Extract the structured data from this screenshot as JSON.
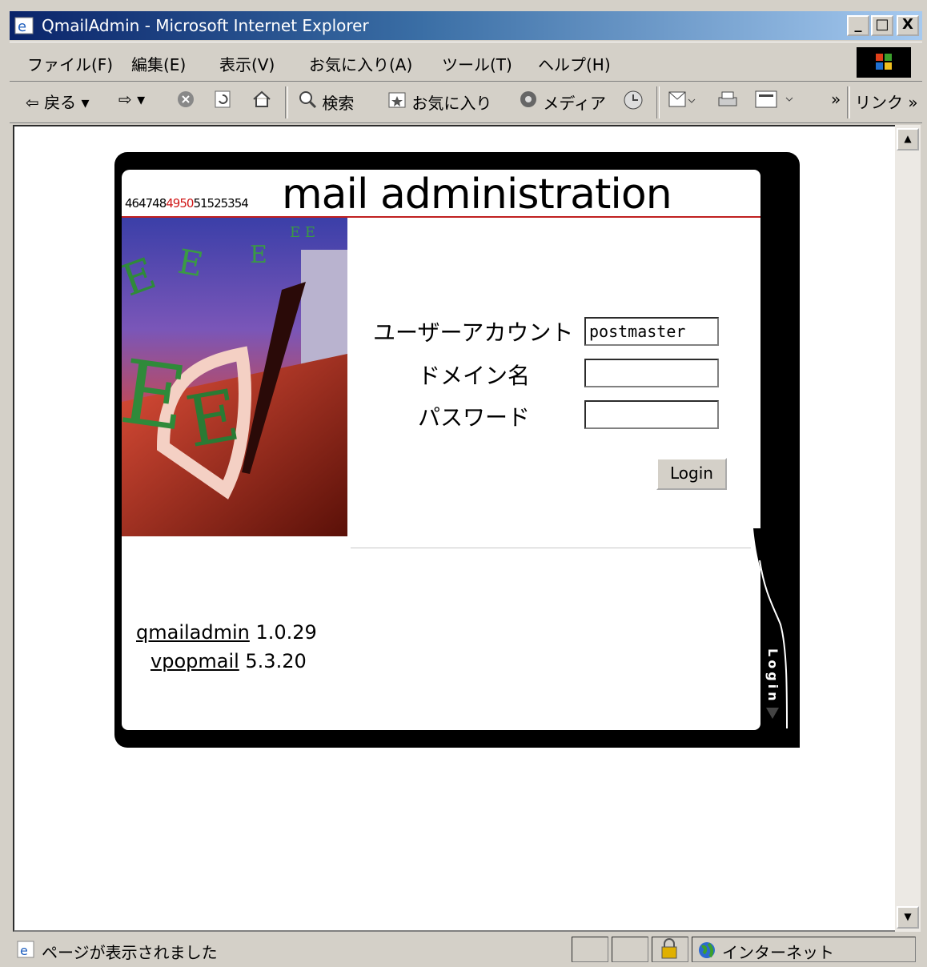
{
  "window": {
    "title": "QmailAdmin - Microsoft Internet Explorer",
    "buttons": [
      "_",
      "□",
      "X"
    ]
  },
  "menu": [
    "ファイル(F)",
    "編集(E)",
    "表示(V)",
    "お気に入り(A)",
    "ツール(T)",
    "ヘルプ(H)"
  ],
  "toolbar": {
    "back": "⇦ 戻る ▾",
    "forward": "⇨ ▾",
    "search": "検索",
    "favorites": "お気に入り",
    "media": "メディア",
    "chevron": "»",
    "links": "リンク »"
  },
  "page": {
    "title": "mail administration",
    "numbers_black_1": "464748",
    "numbers_red": "4950",
    "numbers_black_2": "51525354",
    "form": {
      "user_label": "ユーザーアカウント",
      "user_value": "postmaster",
      "domain_label": "ドメイン名",
      "domain_value": "",
      "password_label": "パスワード",
      "password_value": "",
      "login_label": "Login"
    },
    "versions": {
      "qmailadmin_link": "qmailadmin",
      "qmailadmin_version": " 1.0.29",
      "vpopmail_link": "vpopmail",
      "vpopmail_version": " 5.3.20"
    },
    "side_label": "Login"
  },
  "status": {
    "text": "ページが表示されました",
    "zone": "インターネット"
  },
  "colors": {
    "accent": "#d01818",
    "titlebar": "#0a246a"
  }
}
